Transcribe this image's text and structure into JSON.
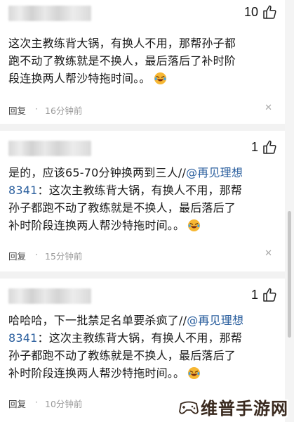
{
  "comments": [
    {
      "likes": "10",
      "text_lines": [
        "这次主教练背大锅，有换人不用，那帮孙子都",
        "跑不动了教练就是不换人，最后落后了补时阶",
        "段连换两人帮沙特拖时间。。"
      ],
      "reply_label": "回复",
      "separator": "·",
      "time": "16分钟前",
      "close": "✕"
    },
    {
      "likes": "1",
      "line1_plain": "是的，应该65-70分钟换两到三人//",
      "line1_mention": "@再见理想",
      "line2_mention": "8341",
      "line2_plain": "：这次主教练背大锅，有换人不用，那帮",
      "text_lines_rest": [
        "孙子都跑不动了教练就是不换人，最后落后了",
        "补时阶段连换两人帮沙特拖时间。。"
      ],
      "reply_label": "回复",
      "separator": "·",
      "time": "15分钟前",
      "close": "✕"
    },
    {
      "likes": "1",
      "line1_plain": "哈哈哈，下一批禁足名单要杀疯了//",
      "line1_mention": "@再见理想",
      "line2_mention": "8341",
      "line2_plain": "：这次主教练背大锅，有换人不用，那帮",
      "text_lines_rest": [
        "孙子都跑不动了教练就是不换人，最后落后了",
        "补时阶段连换两人帮沙特拖时间。。"
      ],
      "reply_label": "回复",
      "separator": "·",
      "time": "10分钟前",
      "close": "✕"
    }
  ],
  "watermark": "维普手游网",
  "colors": {
    "mention": "#2b5f9e",
    "emoji_face": "#f7b733",
    "separator": "#f2f2f2"
  },
  "icons": {
    "like": "thumbs-up-outline",
    "emoji": "laughing-crying-face",
    "close": "x"
  }
}
